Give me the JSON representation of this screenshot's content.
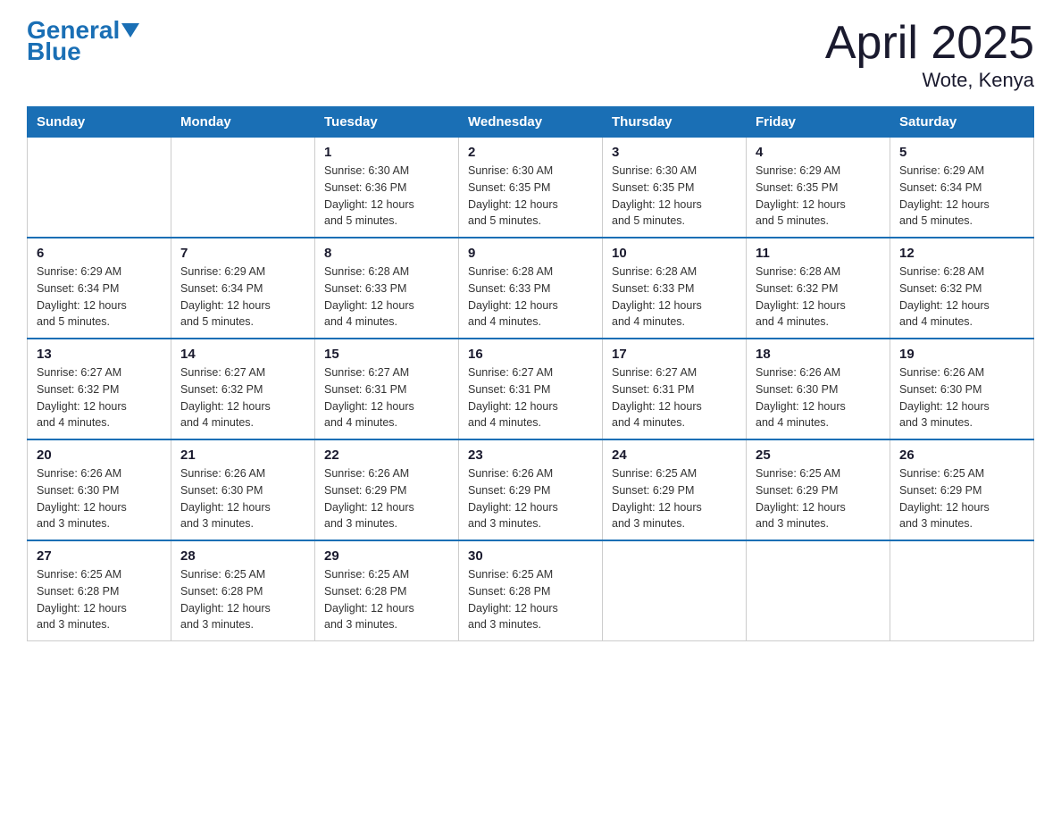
{
  "logo": {
    "text_general": "General",
    "text_blue": "Blue"
  },
  "title": "April 2025",
  "subtitle": "Wote, Kenya",
  "days_of_week": [
    "Sunday",
    "Monday",
    "Tuesday",
    "Wednesday",
    "Thursday",
    "Friday",
    "Saturday"
  ],
  "weeks": [
    [
      {
        "day": "",
        "info": ""
      },
      {
        "day": "",
        "info": ""
      },
      {
        "day": "1",
        "info": "Sunrise: 6:30 AM\nSunset: 6:36 PM\nDaylight: 12 hours\nand 5 minutes."
      },
      {
        "day": "2",
        "info": "Sunrise: 6:30 AM\nSunset: 6:35 PM\nDaylight: 12 hours\nand 5 minutes."
      },
      {
        "day": "3",
        "info": "Sunrise: 6:30 AM\nSunset: 6:35 PM\nDaylight: 12 hours\nand 5 minutes."
      },
      {
        "day": "4",
        "info": "Sunrise: 6:29 AM\nSunset: 6:35 PM\nDaylight: 12 hours\nand 5 minutes."
      },
      {
        "day": "5",
        "info": "Sunrise: 6:29 AM\nSunset: 6:34 PM\nDaylight: 12 hours\nand 5 minutes."
      }
    ],
    [
      {
        "day": "6",
        "info": "Sunrise: 6:29 AM\nSunset: 6:34 PM\nDaylight: 12 hours\nand 5 minutes."
      },
      {
        "day": "7",
        "info": "Sunrise: 6:29 AM\nSunset: 6:34 PM\nDaylight: 12 hours\nand 5 minutes."
      },
      {
        "day": "8",
        "info": "Sunrise: 6:28 AM\nSunset: 6:33 PM\nDaylight: 12 hours\nand 4 minutes."
      },
      {
        "day": "9",
        "info": "Sunrise: 6:28 AM\nSunset: 6:33 PM\nDaylight: 12 hours\nand 4 minutes."
      },
      {
        "day": "10",
        "info": "Sunrise: 6:28 AM\nSunset: 6:33 PM\nDaylight: 12 hours\nand 4 minutes."
      },
      {
        "day": "11",
        "info": "Sunrise: 6:28 AM\nSunset: 6:32 PM\nDaylight: 12 hours\nand 4 minutes."
      },
      {
        "day": "12",
        "info": "Sunrise: 6:28 AM\nSunset: 6:32 PM\nDaylight: 12 hours\nand 4 minutes."
      }
    ],
    [
      {
        "day": "13",
        "info": "Sunrise: 6:27 AM\nSunset: 6:32 PM\nDaylight: 12 hours\nand 4 minutes."
      },
      {
        "day": "14",
        "info": "Sunrise: 6:27 AM\nSunset: 6:32 PM\nDaylight: 12 hours\nand 4 minutes."
      },
      {
        "day": "15",
        "info": "Sunrise: 6:27 AM\nSunset: 6:31 PM\nDaylight: 12 hours\nand 4 minutes."
      },
      {
        "day": "16",
        "info": "Sunrise: 6:27 AM\nSunset: 6:31 PM\nDaylight: 12 hours\nand 4 minutes."
      },
      {
        "day": "17",
        "info": "Sunrise: 6:27 AM\nSunset: 6:31 PM\nDaylight: 12 hours\nand 4 minutes."
      },
      {
        "day": "18",
        "info": "Sunrise: 6:26 AM\nSunset: 6:30 PM\nDaylight: 12 hours\nand 4 minutes."
      },
      {
        "day": "19",
        "info": "Sunrise: 6:26 AM\nSunset: 6:30 PM\nDaylight: 12 hours\nand 3 minutes."
      }
    ],
    [
      {
        "day": "20",
        "info": "Sunrise: 6:26 AM\nSunset: 6:30 PM\nDaylight: 12 hours\nand 3 minutes."
      },
      {
        "day": "21",
        "info": "Sunrise: 6:26 AM\nSunset: 6:30 PM\nDaylight: 12 hours\nand 3 minutes."
      },
      {
        "day": "22",
        "info": "Sunrise: 6:26 AM\nSunset: 6:29 PM\nDaylight: 12 hours\nand 3 minutes."
      },
      {
        "day": "23",
        "info": "Sunrise: 6:26 AM\nSunset: 6:29 PM\nDaylight: 12 hours\nand 3 minutes."
      },
      {
        "day": "24",
        "info": "Sunrise: 6:25 AM\nSunset: 6:29 PM\nDaylight: 12 hours\nand 3 minutes."
      },
      {
        "day": "25",
        "info": "Sunrise: 6:25 AM\nSunset: 6:29 PM\nDaylight: 12 hours\nand 3 minutes."
      },
      {
        "day": "26",
        "info": "Sunrise: 6:25 AM\nSunset: 6:29 PM\nDaylight: 12 hours\nand 3 minutes."
      }
    ],
    [
      {
        "day": "27",
        "info": "Sunrise: 6:25 AM\nSunset: 6:28 PM\nDaylight: 12 hours\nand 3 minutes."
      },
      {
        "day": "28",
        "info": "Sunrise: 6:25 AM\nSunset: 6:28 PM\nDaylight: 12 hours\nand 3 minutes."
      },
      {
        "day": "29",
        "info": "Sunrise: 6:25 AM\nSunset: 6:28 PM\nDaylight: 12 hours\nand 3 minutes."
      },
      {
        "day": "30",
        "info": "Sunrise: 6:25 AM\nSunset: 6:28 PM\nDaylight: 12 hours\nand 3 minutes."
      },
      {
        "day": "",
        "info": ""
      },
      {
        "day": "",
        "info": ""
      },
      {
        "day": "",
        "info": ""
      }
    ]
  ]
}
